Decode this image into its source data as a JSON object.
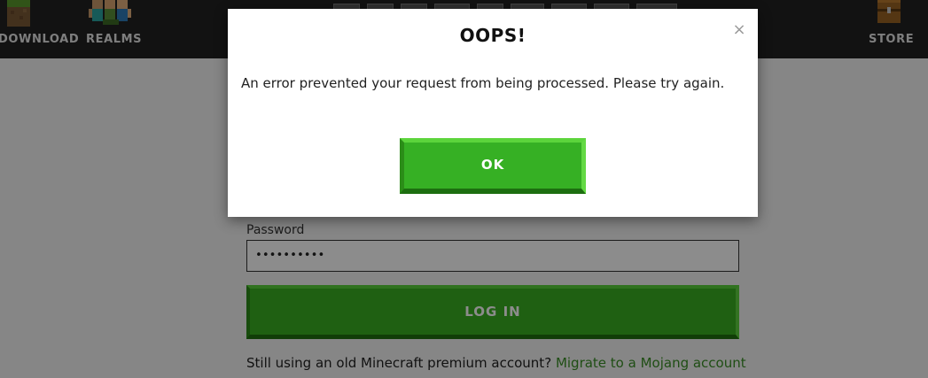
{
  "header": {
    "nav": [
      {
        "label": "DOWNLOAD",
        "icon": "grass-block-icon"
      },
      {
        "label": "REALMS",
        "icon": "realms-characters-icon"
      },
      {
        "label": "STORE",
        "icon": "chest-icon"
      }
    ],
    "bar_color": "#222222"
  },
  "login": {
    "password_label": "Password",
    "password_value": "••••••••••",
    "login_button": "LOG IN",
    "migrate_text": "Still using an old Minecraft premium account?",
    "migrate_link": "Migrate to a Mojang account"
  },
  "modal": {
    "title": "OOPS!",
    "close_icon": "×",
    "message": "An error prevented your request from being processed. Please try again.",
    "ok_label": "OK"
  },
  "colors": {
    "accent_green": "#36b024",
    "link_green": "#3a8e26",
    "overlay": "rgba(0,0,0,0.45)"
  }
}
